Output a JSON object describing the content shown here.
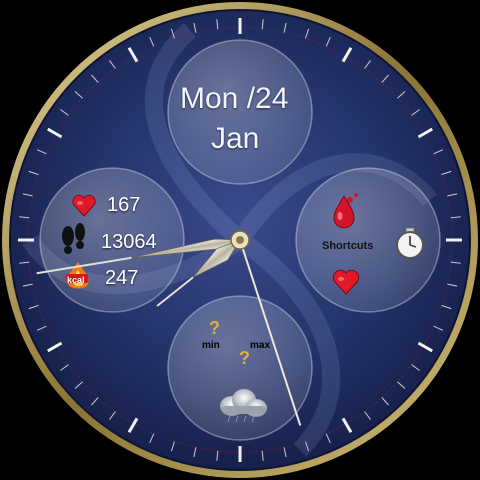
{
  "date": {
    "weekday_day": "Mon /24",
    "month": "Jan"
  },
  "health": {
    "heart_rate": "167",
    "steps": "13064",
    "calories": "247",
    "calorie_badge": "kcal"
  },
  "weather": {
    "min_label": "min",
    "max_label": "max",
    "min_value": "?",
    "max_value": "?",
    "current": "?"
  },
  "shortcuts": {
    "label": "Shortcuts"
  },
  "time": {
    "hour": 7,
    "minute": 43,
    "second": 27
  },
  "colors": {
    "dial": "#1f2a5c",
    "bezel": "#b49a55",
    "accent_red": "#e0182a"
  },
  "icons": {
    "heart": "heart-icon",
    "steps": "footprints-icon",
    "calories": "flame-icon",
    "water": "water-drop-icon",
    "stopwatch": "stopwatch-icon",
    "weather": "cloud-icon"
  }
}
